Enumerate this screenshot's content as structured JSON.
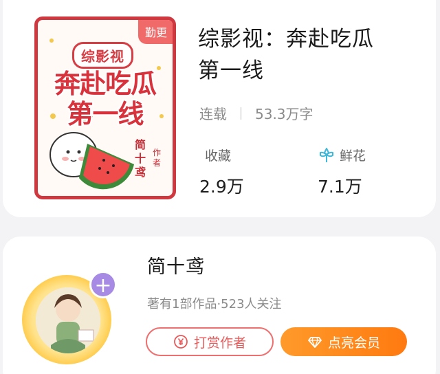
{
  "book": {
    "badge": "勤更",
    "title_line1": "综影视：奔赴吃瓜",
    "title_line2": "第一线",
    "status": "连载",
    "word_count": "53.3万字",
    "cover": {
      "tag": "综影视",
      "title_line1": "奔赴吃瓜",
      "title_line2": "第一线",
      "author": "简十鸢",
      "author_suffix": "作者"
    },
    "stats": [
      {
        "label": "收藏",
        "value": "2.9万",
        "icon": "none"
      },
      {
        "label": "鲜花",
        "value": "7.1万",
        "icon": "flower-icon"
      }
    ]
  },
  "author": {
    "name": "简十鸢",
    "meta": "著有1部作品·523人关注",
    "add_label": "+",
    "buttons": {
      "tip": "打赏作者",
      "vip": "点亮会员"
    }
  },
  "colors": {
    "accent_red": "#e95858",
    "vip_orange": "#ff8a1f",
    "follow_purple": "#a68ae3",
    "flower_teal": "#3fb7d8"
  }
}
